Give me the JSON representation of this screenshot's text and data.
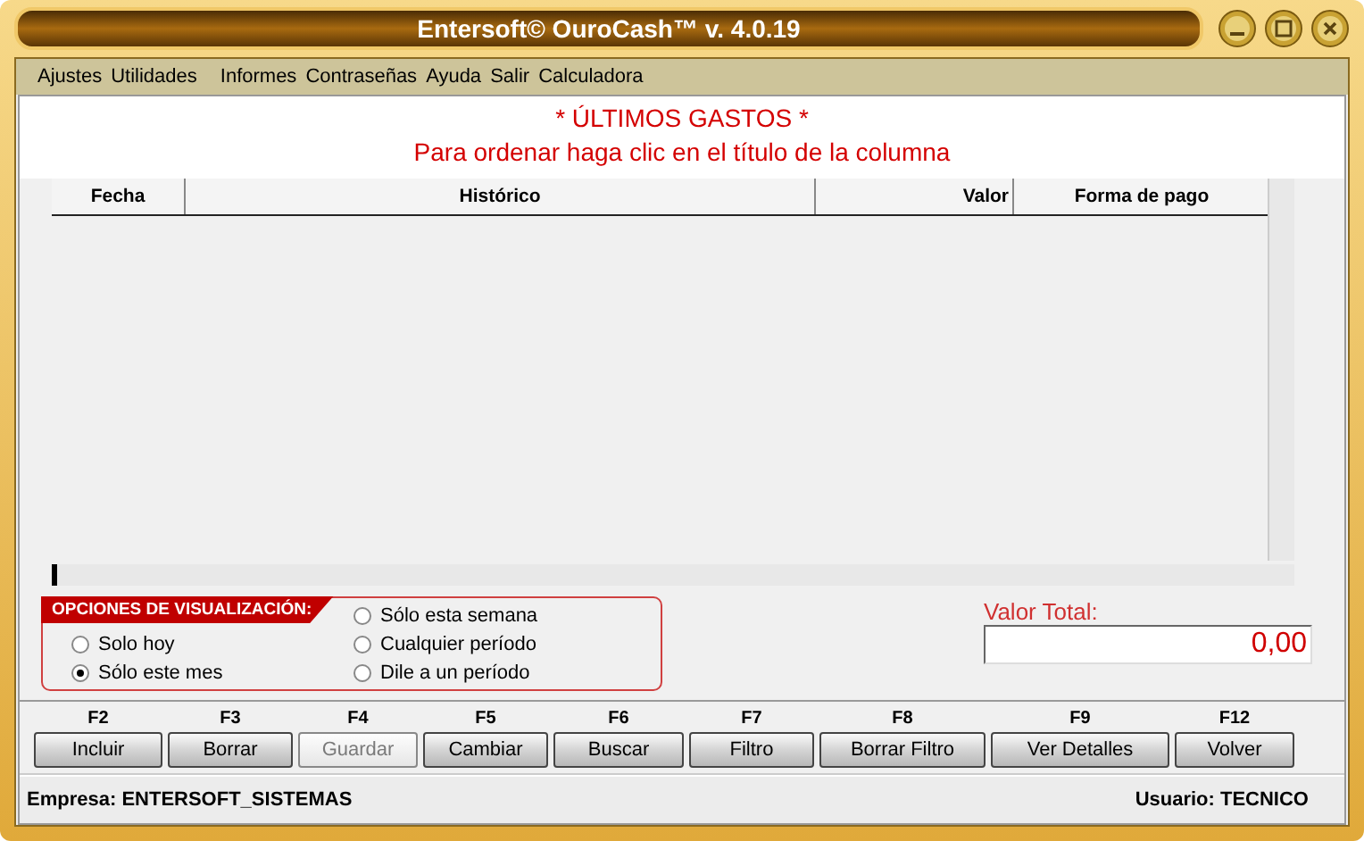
{
  "window": {
    "title": "Entersoft© OuroCash™ v. 4.0.19"
  },
  "menu": [
    "Ajustes",
    "Utilidades",
    "Informes",
    "Contraseñas",
    "Ayuda",
    "Salir",
    "Calculadora"
  ],
  "heading": "* ÚLTIMOS GASTOS *",
  "subheading": "Para ordenar haga clic en el título de la columna",
  "table": {
    "columns": [
      {
        "label": "Fecha",
        "kind": "text"
      },
      {
        "label": "Histórico",
        "kind": "text"
      },
      {
        "label": "Valor",
        "kind": "number"
      },
      {
        "label": "Forma de pago",
        "kind": "text"
      }
    ]
  },
  "options": {
    "title": "OPCIONES DE VISUALIZACIÓN:",
    "items": [
      {
        "label": "Solo hoy",
        "selected": false
      },
      {
        "label": "Sólo este mes",
        "selected": true
      },
      {
        "label": "Sólo esta semana",
        "selected": false
      },
      {
        "label": "Cualquier período",
        "selected": false
      },
      {
        "label": "Dile a un período",
        "selected": false
      }
    ]
  },
  "total": {
    "label": "Valor Total:",
    "value": "0,00"
  },
  "buttons": [
    {
      "key": "F2",
      "label": "Incluir",
      "disabled": false
    },
    {
      "key": "F3",
      "label": "Borrar",
      "disabled": false
    },
    {
      "key": "F4",
      "label": "Guardar",
      "disabled": true
    },
    {
      "key": "F5",
      "label": "Cambiar",
      "disabled": false
    },
    {
      "key": "F6",
      "label": "Buscar",
      "disabled": false
    },
    {
      "key": "F7",
      "label": "Filtro",
      "disabled": false
    },
    {
      "key": "F8",
      "label": "Borrar Filtro",
      "disabled": false
    },
    {
      "key": "F9",
      "label": "Ver Detalles",
      "disabled": false
    },
    {
      "key": "F12",
      "label": "Volver",
      "disabled": false
    }
  ],
  "status_bar": {
    "company": "Empresa: ENTERSOFT_SISTEMAS",
    "user": "Usuario: TECNICO"
  }
}
